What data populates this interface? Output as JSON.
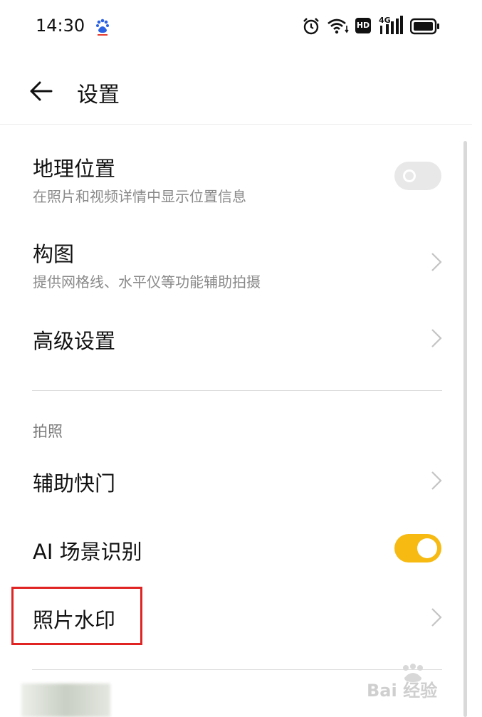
{
  "status_bar": {
    "time": "14:30",
    "network": "4G",
    "hd_label": "HD",
    "icons": [
      "baidu-app-icon",
      "alarm-icon",
      "wifi-icon",
      "hd-icon",
      "signal-4g-icon",
      "battery-icon"
    ]
  },
  "header": {
    "title": "设置",
    "back_icon": "arrow-left-icon"
  },
  "settings": {
    "location": {
      "title": "地理位置",
      "subtitle": "在照片和视频详情中显示位置信息",
      "toggle_on": false
    },
    "composition": {
      "title": "构图",
      "subtitle": "提供网格线、水平仪等功能辅助拍摄"
    },
    "advanced": {
      "title": "高级设置"
    },
    "section_label": "拍照",
    "assist_shutter": {
      "title": "辅助快门"
    },
    "ai_scene": {
      "title": "AI 场景识别",
      "toggle_on": true
    },
    "photo_watermark": {
      "title": "照片水印"
    }
  },
  "overlay": {
    "watermark_text": "Bai 经验",
    "highlight_color": "#e02424"
  },
  "colors": {
    "toggle_on": "#f6ba12",
    "toggle_off": "#e8e8e8"
  }
}
